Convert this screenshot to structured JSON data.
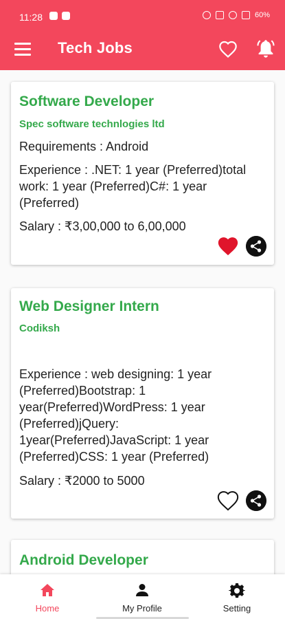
{
  "status_bar": {
    "time": "11:28",
    "battery": "60%"
  },
  "app_bar": {
    "title": "Tech Jobs",
    "menu_icon": "menu-icon",
    "favorites_icon": "heart-outline-icon",
    "notifications_icon": "bell-icon"
  },
  "colors": {
    "primary": "#f3475c",
    "accent_green": "#34a94b",
    "favorite_red": "#e0152b"
  },
  "jobs": [
    {
      "title": "Software Developer",
      "company": "Spec software technlogies ltd",
      "requirements": "Requirements : Android",
      "experience": "Experience : .NET: 1 year (Preferred)total work: 1 year (Preferred)C#: 1 year (Preferred)",
      "salary": "Salary : ₹3,00,000 to 6,00,000",
      "favorited": true
    },
    {
      "title": "Web Designer Intern",
      "company": "Codiksh",
      "requirements": "",
      "experience": "Experience : web designing: 1 year (Preferred)Bootstrap: 1 year(Preferred)WordPress: 1 year (Preferred)jQuery: 1year(Preferred)JavaScript: 1 year (Preferred)CSS: 1 year (Preferred)",
      "salary": "Salary : ₹2000 to 5000",
      "favorited": false
    },
    {
      "title": "Android Developer"
    }
  ],
  "bottom_nav": [
    {
      "label": "Home",
      "icon": "home-icon",
      "active": true
    },
    {
      "label": "My Profile",
      "icon": "person-icon",
      "active": false
    },
    {
      "label": "Setting",
      "icon": "gear-icon",
      "active": false
    }
  ]
}
